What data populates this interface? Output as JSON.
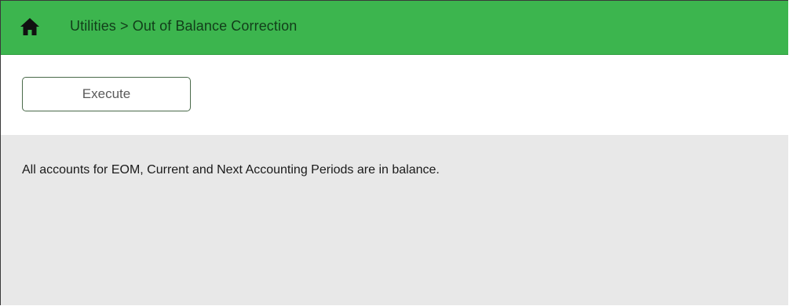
{
  "header": {
    "breadcrumb": "Utilities > Out of Balance Correction",
    "home_icon": "home-icon",
    "background_color": "#3cb54e"
  },
  "toolbar": {
    "execute_label": "Execute"
  },
  "content": {
    "message": "All accounts for EOM, Current and Next Accounting Periods are in balance.",
    "background_color": "#e8e8e8"
  }
}
